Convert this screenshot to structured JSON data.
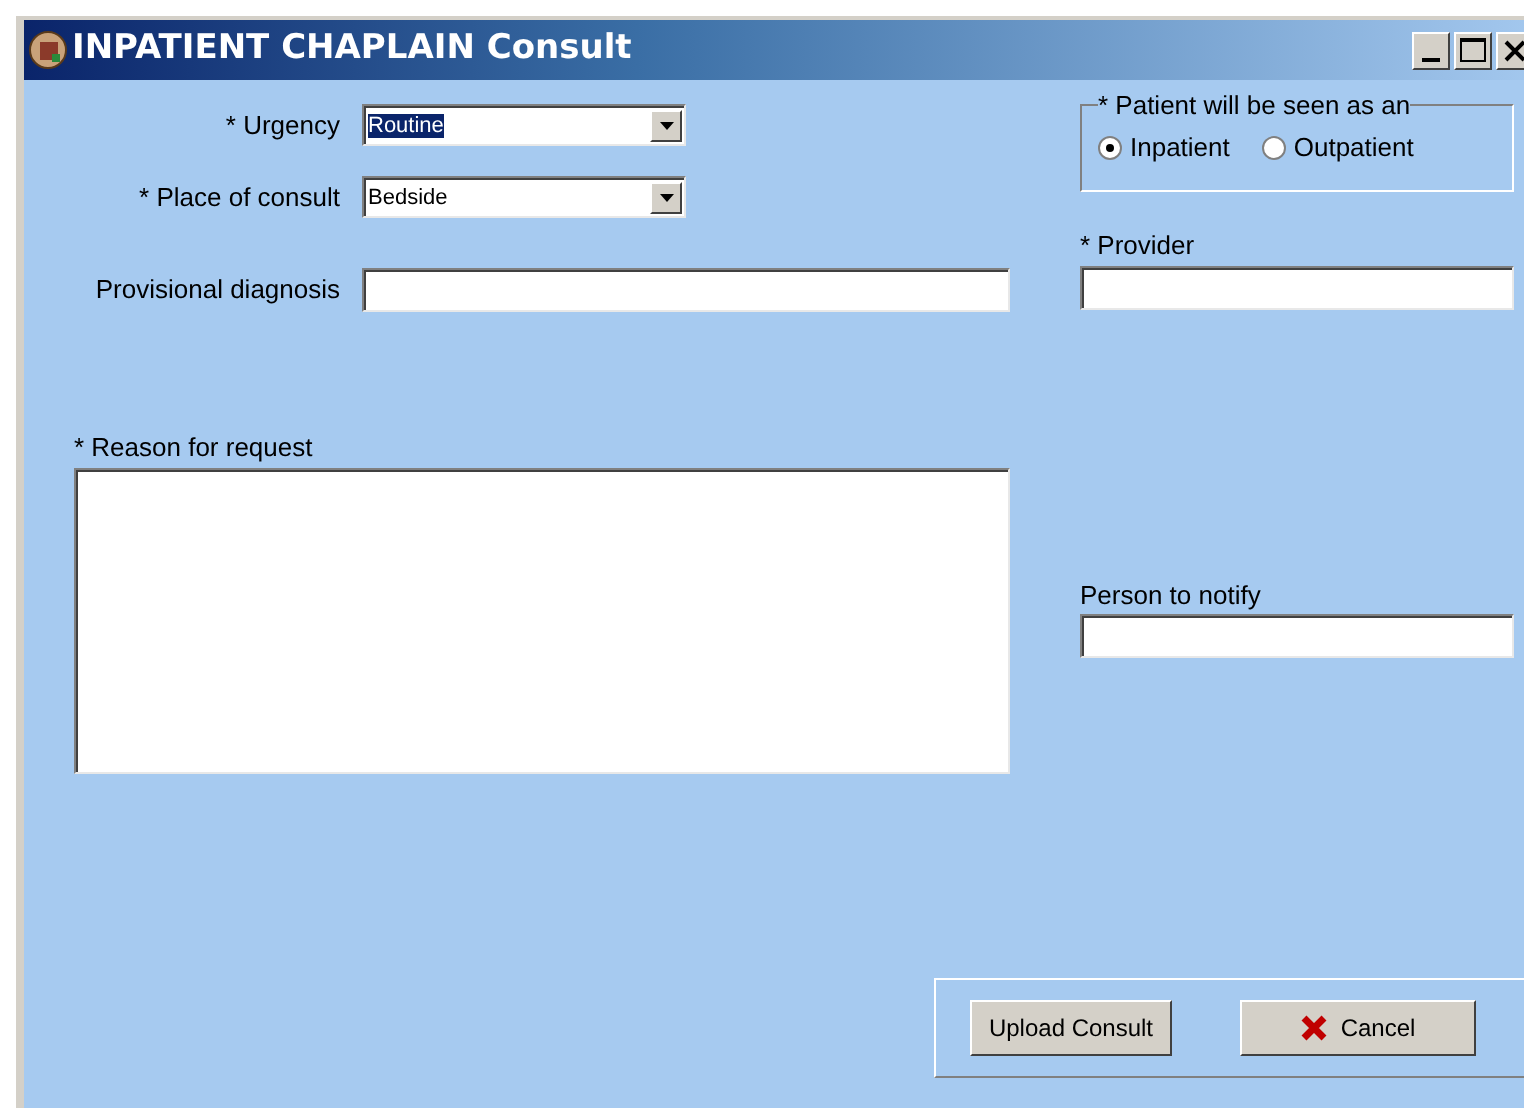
{
  "window": {
    "title": "INPATIENT CHAPLAIN Consult"
  },
  "left_fields": [
    {
      "kind": "combo",
      "label": "* Urgency",
      "value": "Routine",
      "highlighted": true
    },
    {
      "kind": "combo",
      "label": "* Place of consult",
      "value": "Bedside",
      "highlighted": false
    },
    {
      "kind": "text",
      "label": "Provisional diagnosis"
    }
  ],
  "reason": {
    "label": "* Reason for request"
  },
  "seen_as": {
    "legend": "* Patient will be seen as an",
    "options": [
      {
        "label": "Inpatient",
        "selected": true
      },
      {
        "label": "Outpatient",
        "selected": false
      }
    ]
  },
  "right_fields": [
    {
      "label": "* Provider"
    },
    {
      "label": "Person to notify"
    }
  ],
  "buttons": [
    {
      "kind": "plain",
      "label": "Upload Consult"
    },
    {
      "kind": "cancel",
      "label": "Cancel"
    }
  ]
}
